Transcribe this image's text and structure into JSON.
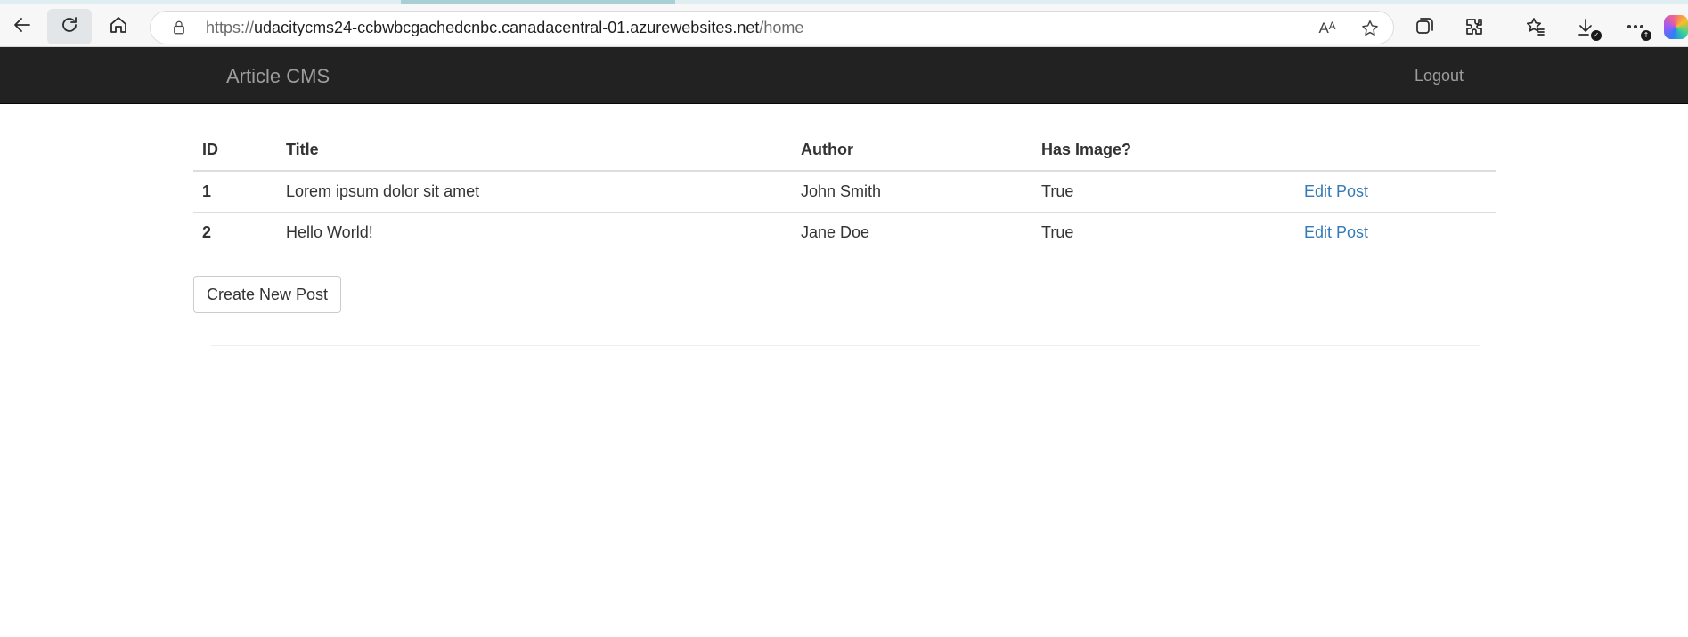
{
  "browser": {
    "url_prefix": "https://",
    "url_host": "udacitycms24-ccbwbcgachedcnbc.canadacentral-01.azurewebsites.net",
    "url_path": "/home",
    "read_aloud_label": "Aᴬ"
  },
  "navbar": {
    "brand": "Article CMS",
    "logout": "Logout"
  },
  "table": {
    "headers": {
      "id": "ID",
      "title": "Title",
      "author": "Author",
      "has_image": "Has Image?"
    },
    "rows": [
      {
        "id": "1",
        "title": "Lorem ipsum dolor sit amet",
        "author": "John Smith",
        "has_image": "True",
        "action": "Edit Post"
      },
      {
        "id": "2",
        "title": "Hello World!",
        "author": "Jane Doe",
        "has_image": "True",
        "action": "Edit Post"
      }
    ]
  },
  "actions": {
    "create_new_post": "Create New Post"
  },
  "colors": {
    "navbar_bg": "#222222",
    "navbar_text": "#9d9d9d",
    "link": "#337ab7"
  },
  "icons": [
    "back-icon",
    "refresh-icon",
    "home-icon",
    "lock-icon",
    "read-aloud-icon",
    "favorite-star-icon",
    "collections-icon",
    "extensions-icon",
    "favorites-icon",
    "downloads-icon",
    "more-icon",
    "copilot-icon"
  ]
}
